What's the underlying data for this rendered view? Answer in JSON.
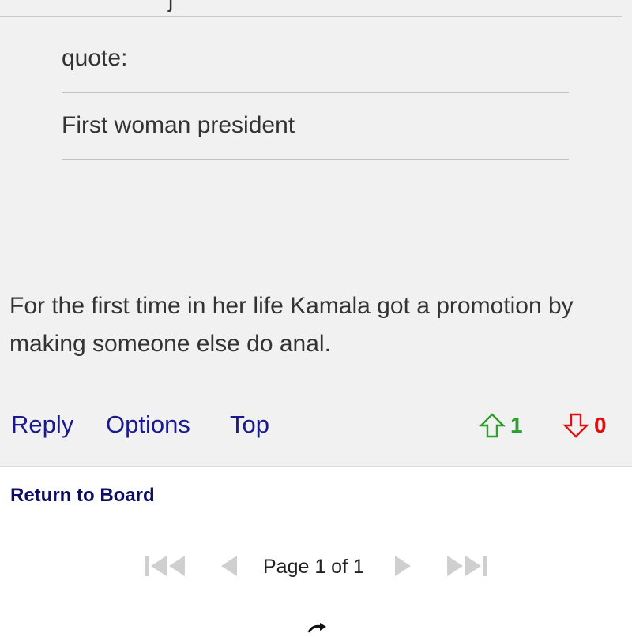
{
  "post": {
    "top_fragment": "j",
    "quote": {
      "label": "quote:",
      "text": "First woman president"
    },
    "body": "For the first time in her life Kamala got a promotion by making someone else do anal.",
    "actions": {
      "reply": "Reply",
      "options": "Options",
      "top": "Top"
    },
    "votes": {
      "up": "1",
      "down": "0",
      "up_color": "#2e9e2e",
      "down_color": "#e01010"
    }
  },
  "nav": {
    "return_to_board": "Return to Board"
  },
  "pagination": {
    "label": "Page 1 of 1",
    "current_page": 1,
    "total_pages": 1
  },
  "colors": {
    "post_background": "#f1f1f1",
    "link": "#1a1a8c",
    "return_link": "#0d0d66",
    "pager_disabled": "#cfcfcf"
  }
}
